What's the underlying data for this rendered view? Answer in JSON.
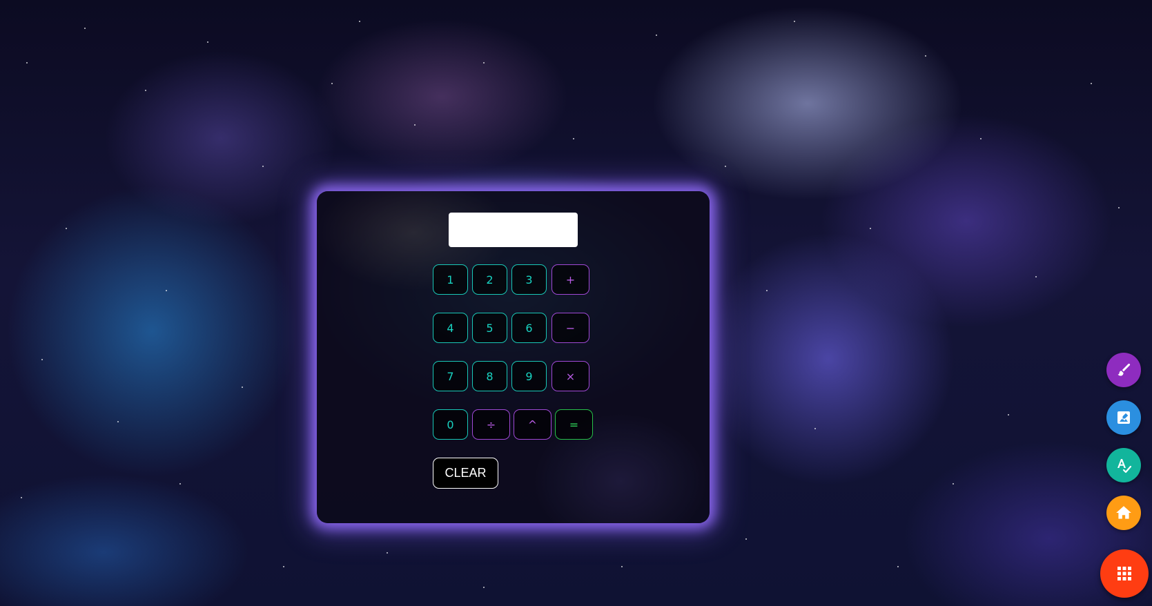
{
  "calculator": {
    "display_value": "",
    "keys": {
      "k1": "1",
      "k2": "2",
      "k3": "3",
      "plus": "+",
      "k4": "4",
      "k5": "5",
      "k6": "6",
      "minus": "−",
      "k7": "7",
      "k8": "8",
      "k9": "9",
      "times": "×",
      "k0": "0",
      "divide": "÷",
      "power": "^",
      "equals": "="
    },
    "clear_label": "CLEAR",
    "colors": {
      "number_key": "#19c9b8",
      "operator_key": "#a049d6",
      "equals_key": "#27c24a",
      "panel_glow": "#9670ff"
    }
  },
  "side_actions": [
    {
      "icon": "paintbrush-icon",
      "color": "#8e2cbf"
    },
    {
      "icon": "image-edit-icon",
      "color": "#2b8fe0"
    },
    {
      "icon": "spellcheck-icon",
      "color": "#12b59c"
    },
    {
      "icon": "home-icon",
      "color": "#ff9c14"
    },
    {
      "icon": "grid-menu-icon",
      "color": "#ff3d12"
    }
  ]
}
